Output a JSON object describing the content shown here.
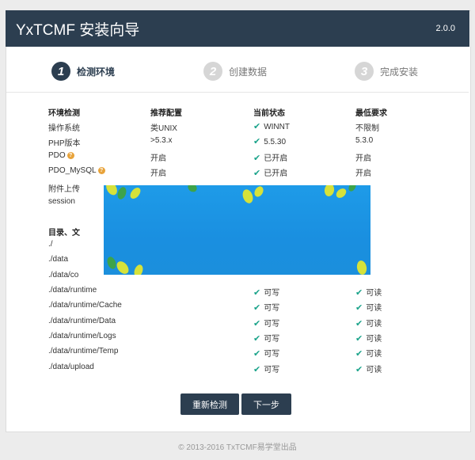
{
  "header": {
    "title": "YxTCMF 安装向导",
    "version": "2.0.0"
  },
  "steps": [
    {
      "number": "1",
      "label": "检测环境"
    },
    {
      "number": "2",
      "label": "创建数据"
    },
    {
      "number": "3",
      "label": "完成安装"
    }
  ],
  "env": {
    "headers": [
      "环境检测",
      "推荐配置",
      "当前状态",
      "最低要求"
    ],
    "rows": [
      {
        "name": "操作系统",
        "recommended": "类UNIX",
        "status": "WINNT",
        "minimum": "不限制"
      },
      {
        "name": "PHP版本",
        "recommended": ">5.3.x",
        "status": "5.5.30",
        "minimum": "5.3.0"
      },
      {
        "name": "PDO",
        "recommended": "开启",
        "status": "已开启",
        "minimum": "开启"
      },
      {
        "name": "PDO_MySQL",
        "recommended": "开启",
        "status": "已开启",
        "minimum": "开启"
      },
      {
        "name": "附件上传"
      },
      {
        "name": "session"
      }
    ]
  },
  "dirs": {
    "header": "目录、文",
    "rows": [
      {
        "path": "./"
      },
      {
        "path": "./data"
      },
      {
        "path": "./data/co"
      },
      {
        "path": "./data/runtime",
        "status": "可写",
        "minimum": "可读"
      },
      {
        "path": "./data/runtime/Cache",
        "status": "可写",
        "minimum": "可读"
      },
      {
        "path": "./data/runtime/Data",
        "status": "可写",
        "minimum": "可读"
      },
      {
        "path": "./data/runtime/Logs",
        "status": "可写",
        "minimum": "可读"
      },
      {
        "path": "./data/runtime/Temp",
        "status": "可写",
        "minimum": "可读"
      },
      {
        "path": "./data/upload",
        "status": "可写",
        "minimum": "可读"
      }
    ]
  },
  "buttons": {
    "recheck": "重新检测",
    "next": "下一步"
  },
  "footer": "© 2013-2016 TxTCMF易学堂出品",
  "colors": {
    "header_bg": "#2c3e50",
    "check_green": "#1aa38a",
    "banner_blue": "#1e9be8"
  }
}
